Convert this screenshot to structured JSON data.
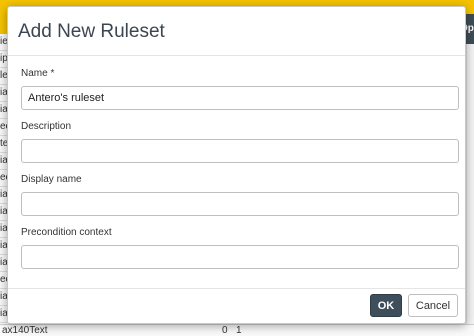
{
  "background": {
    "top_right_label": "Op",
    "left_list_rows": [
      "ie",
      "ip",
      "le",
      "ia",
      "ia",
      "ee",
      "te",
      "ia",
      "ee",
      "ia",
      "ia",
      "ia",
      "ia",
      "ia",
      "ee",
      "ia",
      "ia",
      "ia"
    ],
    "bottom_row": {
      "text": "ax140Text",
      "col2": "0",
      "col3": "1"
    }
  },
  "dialog": {
    "title": "Add New Ruleset",
    "fields": [
      {
        "label": "Name *",
        "value": "Antero's ruleset"
      },
      {
        "label": "Description",
        "value": ""
      },
      {
        "label": "Display name",
        "value": ""
      },
      {
        "label": "Precondition context",
        "value": ""
      }
    ],
    "ok_label": "OK",
    "cancel_label": "Cancel"
  },
  "colors": {
    "topbar": "#f5c400",
    "primary_button": "#3e4f5b",
    "title_text": "#3b4651"
  }
}
